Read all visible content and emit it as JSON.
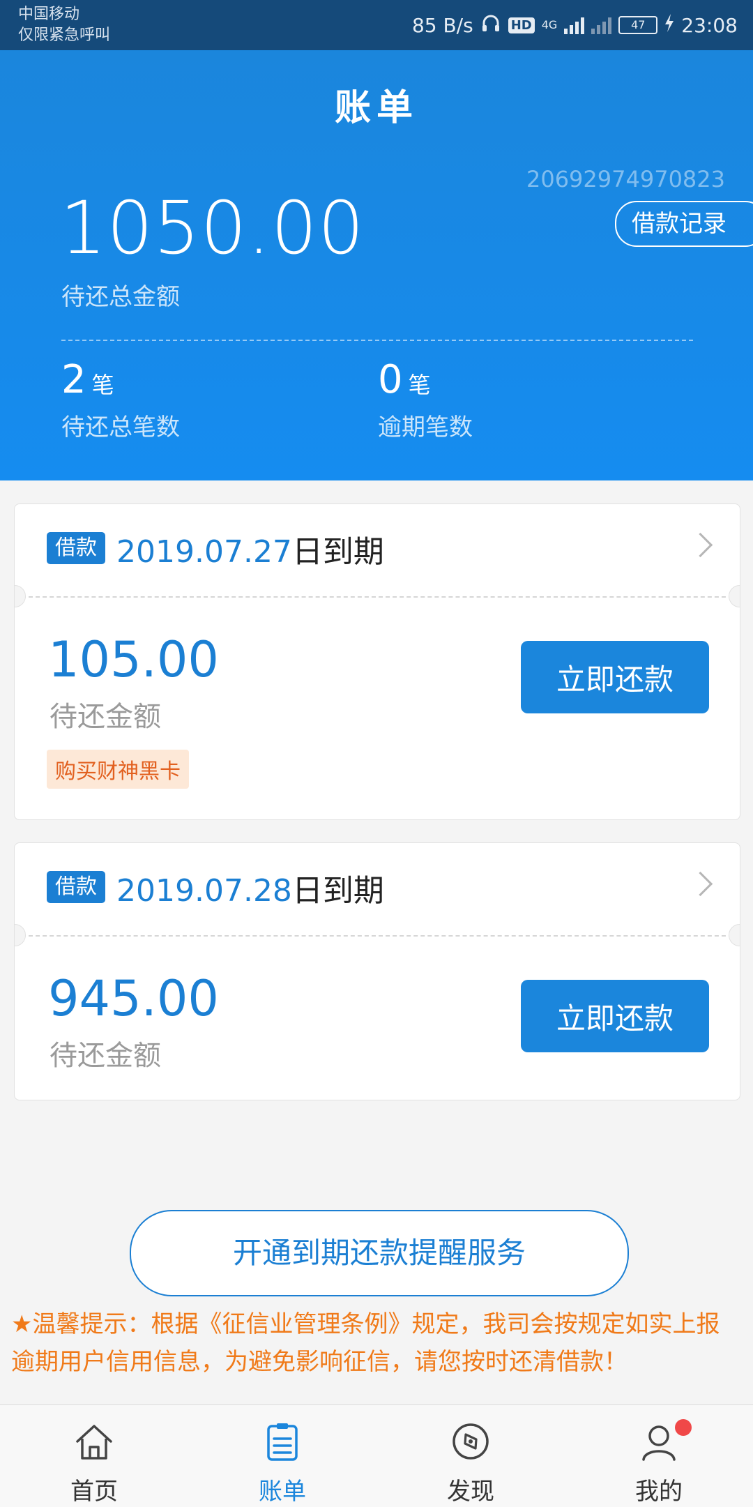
{
  "status_bar": {
    "carrier_line1": "中国移动",
    "carrier_line2": "仅限紧急呼叫",
    "speed": "85 B/s",
    "hd": "HD",
    "network": "4G",
    "battery": "47",
    "time": "23:08"
  },
  "header": {
    "title": "账单",
    "account_no": "20692974970823",
    "history_button": "借款记录",
    "total_amount": "1050.00",
    "total_label": "待还总金额",
    "pending_count": "2",
    "pending_unit": "笔",
    "pending_label": "待还总笔数",
    "overdue_count": "0",
    "overdue_unit": "笔",
    "overdue_label": "逾期笔数"
  },
  "bills": [
    {
      "tag": "借款",
      "date": "2019.07.27",
      "due_suffix": "日到期",
      "amount": "105.00",
      "amount_label": "待还金额",
      "promo": "购买财神黑卡",
      "pay_button": "立即还款"
    },
    {
      "tag": "借款",
      "date": "2019.07.28",
      "due_suffix": "日到期",
      "amount": "945.00",
      "amount_label": "待还金额",
      "pay_button": "立即还款"
    }
  ],
  "remind_button": "开通到期还款提醒服务",
  "notice": "★温馨提示：根据《征信业管理条例》规定，我司会按规定如实上报逾期用户信用信息，为避免影响征信，请您按时还清借款！",
  "tabs": [
    {
      "label": "首页",
      "icon": "home-icon",
      "active": false
    },
    {
      "label": "账单",
      "icon": "bill-icon",
      "active": true
    },
    {
      "label": "发现",
      "icon": "compass-icon",
      "active": false
    },
    {
      "label": "我的",
      "icon": "user-icon",
      "active": false
    }
  ],
  "colors": {
    "primary": "#1b86dc",
    "status_bar": "#154a7a",
    "notice": "#f07a19",
    "badge_dot": "#f04848"
  }
}
